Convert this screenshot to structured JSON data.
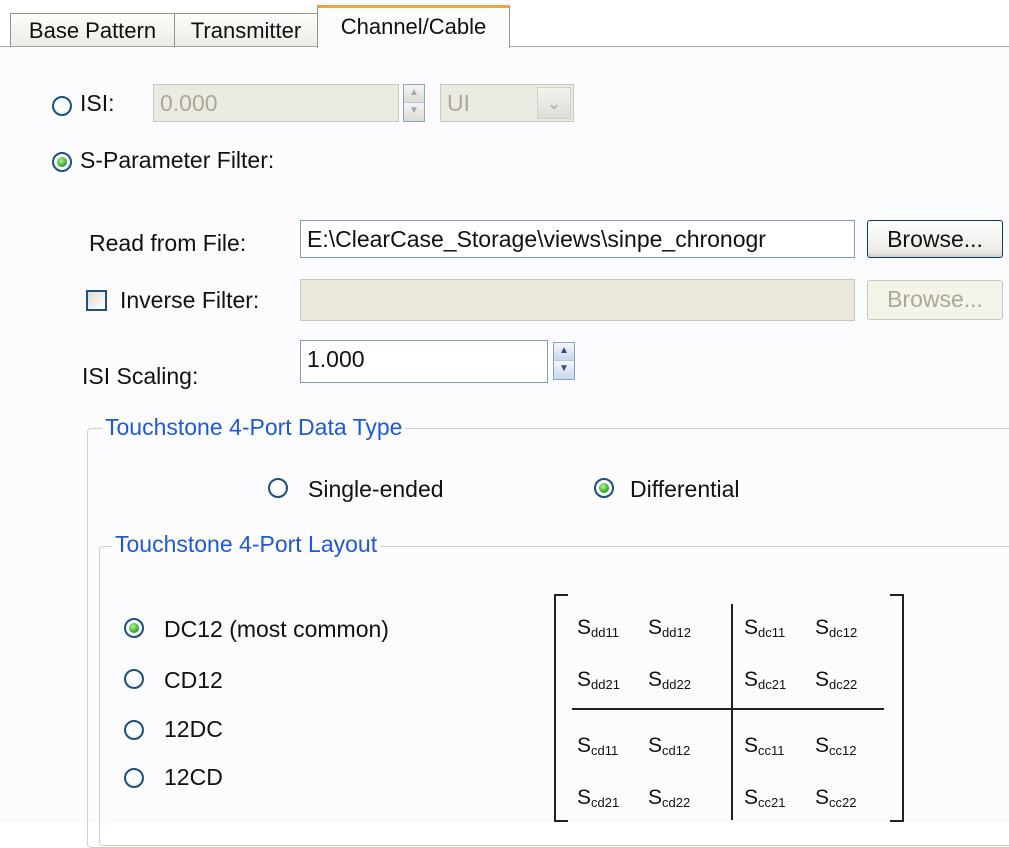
{
  "tabs": [
    {
      "label": "Base Pattern",
      "active": false
    },
    {
      "label": "Transmitter",
      "active": false
    },
    {
      "label": "Channel/Cable",
      "active": true
    }
  ],
  "isi": {
    "label": "ISI:",
    "selected": false,
    "value": "0.000",
    "unit": "UI"
  },
  "sparam": {
    "label": "S-Parameter Filter:",
    "selected": true
  },
  "read_file": {
    "label": "Read from File:",
    "value": "E:\\ClearCase_Storage\\views\\sinpe_chronogr",
    "browse": "Browse..."
  },
  "inverse_filter": {
    "label": "Inverse Filter:",
    "checked": false,
    "value": "",
    "browse": "Browse..."
  },
  "isi_scaling": {
    "label": "ISI Scaling:",
    "value": "1.000"
  },
  "data_type": {
    "title": "Touchstone 4-Port Data Type",
    "options": [
      {
        "label": "Single-ended",
        "selected": false
      },
      {
        "label": "Differential",
        "selected": true
      }
    ]
  },
  "layout": {
    "title": "Touchstone 4-Port Layout",
    "options": [
      {
        "label": "DC12 (most common)",
        "selected": true
      },
      {
        "label": "CD12",
        "selected": false
      },
      {
        "label": "12DC",
        "selected": false
      },
      {
        "label": "12CD",
        "selected": false
      }
    ],
    "matrix": [
      [
        "dd11",
        "dd12",
        "dc11",
        "dc12"
      ],
      [
        "dd21",
        "dd22",
        "dc21",
        "dc22"
      ],
      [
        "cd11",
        "cd12",
        "cc11",
        "cc12"
      ],
      [
        "cd21",
        "cd22",
        "cc21",
        "cc22"
      ]
    ],
    "matrix_symbol": "S"
  },
  "icons": {
    "spin_up": "spin-up-icon",
    "spin_down": "spin-down-icon",
    "dropdown": "chevron-down-icon"
  }
}
